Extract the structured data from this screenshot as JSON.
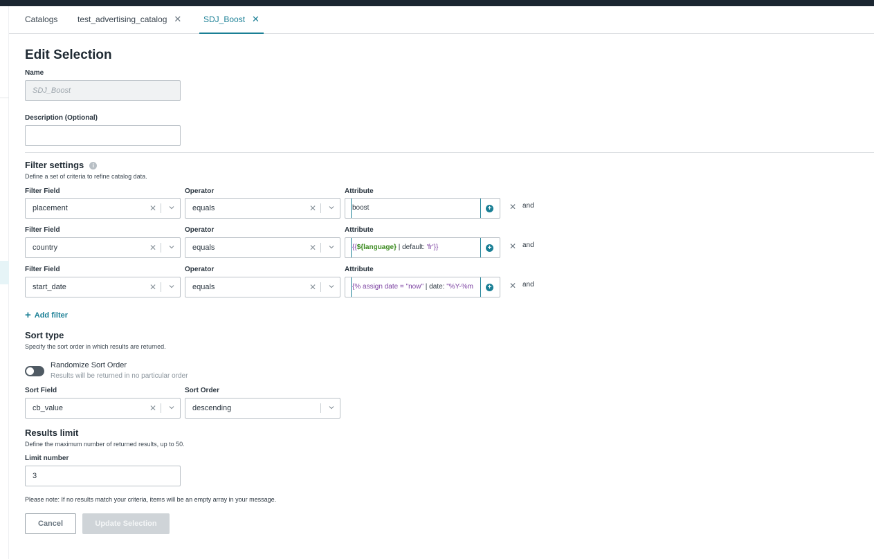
{
  "tabs": [
    {
      "label": "Catalogs",
      "closable": false
    },
    {
      "label": "test_advertising_catalog",
      "closable": true
    },
    {
      "label": "SDJ_Boost",
      "closable": true,
      "active": true
    }
  ],
  "close_glyph": "✕",
  "page_title": "Edit Selection",
  "name_field": {
    "label": "Name",
    "value": "SDJ_Boost"
  },
  "description_field": {
    "label": "Description (Optional)",
    "value": ""
  },
  "filter_settings": {
    "title": "Filter settings",
    "description": "Define a set of criteria to refine catalog data.",
    "field_label": "Filter Field",
    "operator_label": "Operator",
    "attribute_label": "Attribute",
    "and_label": "and",
    "rows": [
      {
        "field": "placement",
        "operator": "equals",
        "attribute": "boost"
      },
      {
        "field": "country",
        "operator": "equals",
        "attribute_parts": [
          "{{",
          "${language}",
          " | default: ",
          "'fr'",
          "}}"
        ]
      },
      {
        "field": "start_date",
        "operator": "equals",
        "attribute_parts": [
          "{% assign date = ",
          "\"now\"",
          " | date: ",
          "\"%Y-%m"
        ]
      }
    ],
    "add_filter_label": "Add filter"
  },
  "sort_type": {
    "title": "Sort type",
    "description": "Specify the sort order in which results are returned.",
    "randomize_label": "Randomize Sort Order",
    "randomize_sublabel": "Results will be returned in no particular order",
    "randomize_on": false,
    "sort_field_label": "Sort Field",
    "sort_field_value": "cb_value",
    "sort_order_label": "Sort Order",
    "sort_order_value": "descending"
  },
  "results_limit": {
    "title": "Results limit",
    "description": "Define the maximum number of returned results, up to 50.",
    "limit_label": "Limit number",
    "limit_value": "3"
  },
  "note": "Please note: If no results match your criteria, items will be an empty array in your message.",
  "buttons": {
    "cancel": "Cancel",
    "update": "Update Selection"
  },
  "colors": {
    "accent": "#1a7f95",
    "topbar": "#1b2631",
    "liquid_green": "#3a8a1e",
    "liquid_purple": "#7a3fa0"
  }
}
